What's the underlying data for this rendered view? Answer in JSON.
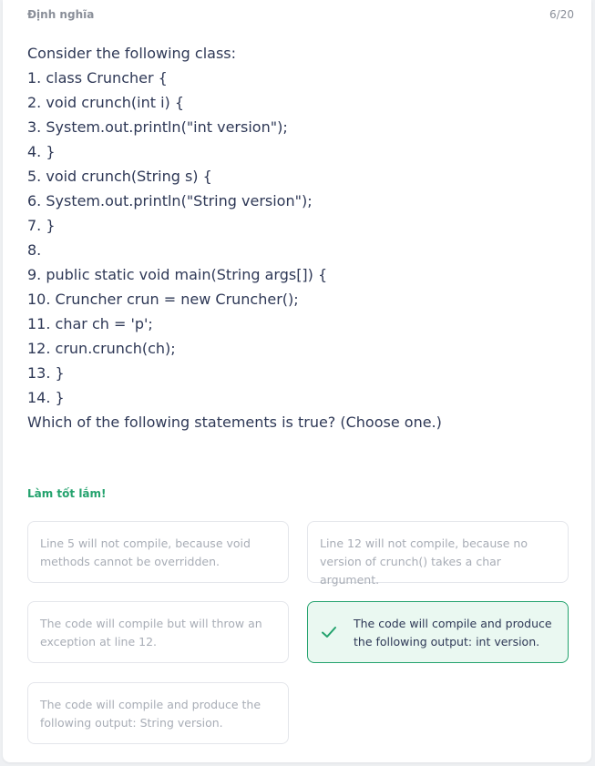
{
  "header": {
    "label": "Định nghĩa",
    "progress": "6/20"
  },
  "question": {
    "lines": [
      "Consider the following class:",
      "1. class Cruncher {",
      "2. void crunch(int i) {",
      "3. System.out.println(\"int version\");",
      "4. }",
      "5. void crunch(String s) {",
      "6. System.out.println(\"String version\");",
      "7. }",
      "8.",
      "9. public static void main(String args[]) {",
      "10. Cruncher crun = new Cruncher();",
      "11. char ch = 'p';",
      "12. crun.crunch(ch);",
      "13. }",
      "14. }",
      "Which of the following statements is true? (Choose one.)"
    ]
  },
  "feedback": "Làm tốt lắm!",
  "options": [
    {
      "text": "Line 5 will not compile, because void methods cannot be overridden.",
      "state": "disabled"
    },
    {
      "text": "Line 12 will not compile, because no version of crunch() takes a char argument.",
      "state": "disabled"
    },
    {
      "text": "The code will compile but will throw an exception at line 12.",
      "state": "disabled"
    },
    {
      "text": "The code will compile and produce the following output: int version.",
      "state": "correct",
      "icon": "check-icon"
    },
    {
      "text": "The code will compile and produce the following output: String version.",
      "state": "disabled"
    }
  ],
  "colors": {
    "correct": "#23a26d",
    "correct_bg": "#eaf8f1",
    "muted_text": "#a8adb6",
    "main_text": "#2e3856"
  }
}
